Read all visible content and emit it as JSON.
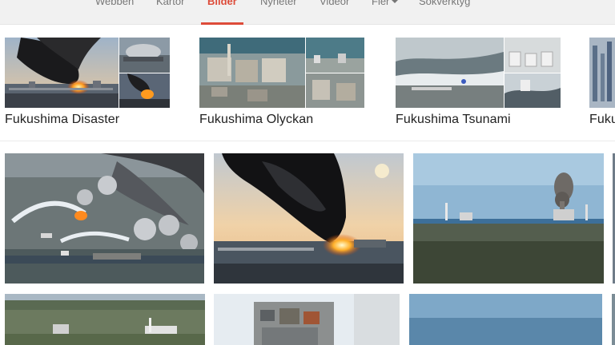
{
  "nav": {
    "tabs": [
      {
        "label": "Webben"
      },
      {
        "label": "Kartor"
      },
      {
        "label": "Bilder",
        "active": true
      },
      {
        "label": "Nyheter"
      },
      {
        "label": "Videor"
      },
      {
        "label": "Fler"
      },
      {
        "label": "Sökverktyg"
      }
    ]
  },
  "related_searches": [
    {
      "label": "Fukushima Disaster"
    },
    {
      "label": "Fukushima Olyckan"
    },
    {
      "label": "Fukushima Tsunami"
    },
    {
      "label": "Fuku"
    }
  ],
  "colors": {
    "active_tab": "#dd4b39",
    "tab_text": "#777777",
    "topbar_bg": "#f1f1f1"
  },
  "icons": {
    "more_caret": "chevron-down-icon"
  }
}
